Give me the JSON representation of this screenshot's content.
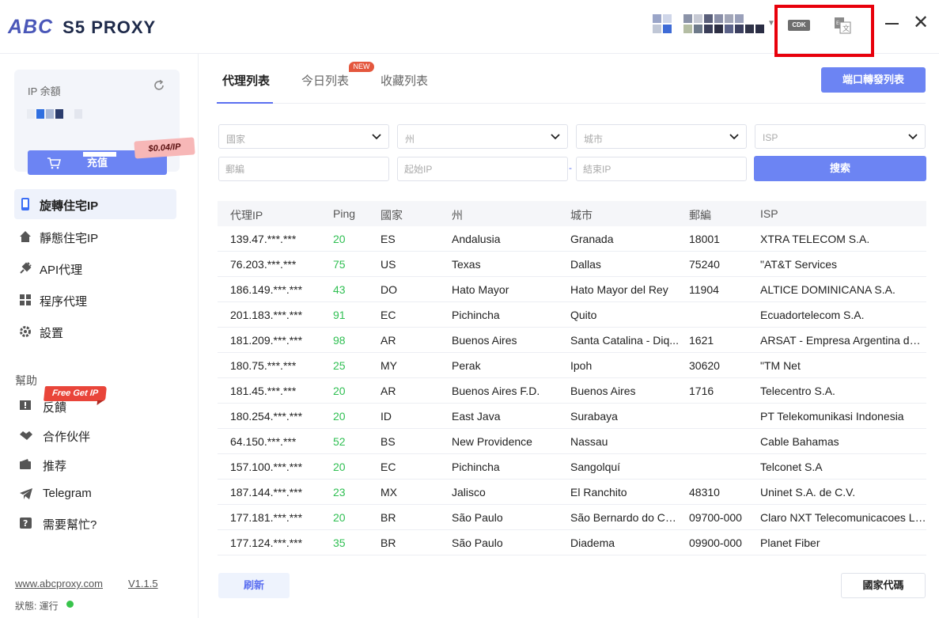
{
  "header": {
    "logo_abc": "ABC",
    "logo_product": "S5 PROXY",
    "cdk_label": "CDK",
    "lang_label": "En",
    "close_glyph": "✕"
  },
  "balance": {
    "label": "IP 余額",
    "price": "$0.04/IP",
    "recharge": "充值"
  },
  "nav": {
    "items": [
      {
        "label": "旋轉住宅IP",
        "icon": "phone-icon"
      },
      {
        "label": "靜態住宅IP",
        "icon": "home-icon"
      },
      {
        "label": "API代理",
        "icon": "plug-icon"
      },
      {
        "label": "程序代理",
        "icon": "grid-icon"
      },
      {
        "label": "設置",
        "icon": "gear-icon"
      }
    ]
  },
  "help": {
    "title": "幫助",
    "free_badge": "Free Get IP",
    "items": [
      {
        "label": "反饋",
        "icon": "feedback-icon"
      },
      {
        "label": "合作伙伴",
        "icon": "handshake-icon"
      },
      {
        "label": "推荐",
        "icon": "wallet-icon"
      },
      {
        "label": "Telegram",
        "icon": "telegram-icon"
      },
      {
        "label": "需要幫忙?",
        "icon": "question-icon"
      }
    ]
  },
  "footer": {
    "site": "www.abcproxy.com",
    "version": "V1.1.5",
    "status": "狀態: 運行"
  },
  "tabs": {
    "items": [
      "代理列表",
      "今日列表",
      "收藏列表"
    ],
    "new_badge": "NEW",
    "port_button": "端口轉發列表"
  },
  "filters": {
    "country": "國家",
    "state": "州",
    "city": "城市",
    "isp": "ISP",
    "zip_placeholder": "郵編",
    "start_ip_placeholder": "起始IP",
    "end_ip_placeholder": "結束IP",
    "dash": "-",
    "search": "搜索"
  },
  "table": {
    "headers": [
      "代理IP",
      "Ping",
      "國家",
      "州",
      "城市",
      "郵編",
      "ISP"
    ],
    "rows": [
      [
        "139.47.***.***",
        "20",
        "ES",
        "Andalusia",
        "Granada",
        "18001",
        "XTRA TELECOM S.A."
      ],
      [
        "76.203.***.***",
        "75",
        "US",
        "Texas",
        "Dallas",
        "75240",
        "\"AT&T Services"
      ],
      [
        "186.149.***.***",
        "43",
        "DO",
        "Hato Mayor",
        "Hato Mayor del Rey",
        "11904",
        "ALTICE DOMINICANA S.A."
      ],
      [
        "201.183.***.***",
        "91",
        "EC",
        "Pichincha",
        "Quito",
        "",
        "Ecuadortelecom S.A."
      ],
      [
        "181.209.***.***",
        "98",
        "AR",
        "Buenos Aires",
        "Santa Catalina - Diq...",
        "1621",
        "ARSAT - Empresa Argentina de ..."
      ],
      [
        "180.75.***.***",
        "25",
        "MY",
        "Perak",
        "Ipoh",
        "30620",
        "\"TM Net"
      ],
      [
        "181.45.***.***",
        "20",
        "AR",
        "Buenos Aires F.D.",
        "Buenos Aires",
        "1716",
        "Telecentro S.A."
      ],
      [
        "180.254.***.***",
        "20",
        "ID",
        "East Java",
        "Surabaya",
        "",
        "PT Telekomunikasi Indonesia"
      ],
      [
        "64.150.***.***",
        "52",
        "BS",
        "New Providence",
        "Nassau",
        "",
        "Cable Bahamas"
      ],
      [
        "157.100.***.***",
        "20",
        "EC",
        "Pichincha",
        "Sangolquí",
        "",
        "Telconet S.A"
      ],
      [
        "187.144.***.***",
        "23",
        "MX",
        "Jalisco",
        "El Ranchito",
        "48310",
        "Uninet S.A. de C.V."
      ],
      [
        "177.181.***.***",
        "20",
        "BR",
        "São Paulo",
        "São Bernardo do Ca...",
        "09700-000",
        "Claro NXT Telecomunicacoes Ltda"
      ],
      [
        "177.124.***.***",
        "35",
        "BR",
        "São Paulo",
        "Diadema",
        "09900-000",
        "Planet Fiber"
      ]
    ]
  },
  "actions": {
    "refresh": "刷新",
    "country_code": "國家代碼"
  },
  "colors": {
    "accent": "#6c84f3",
    "ping_good": "#2fbf52",
    "highlight": "#e8000b",
    "new_badge": "#e4573d"
  }
}
